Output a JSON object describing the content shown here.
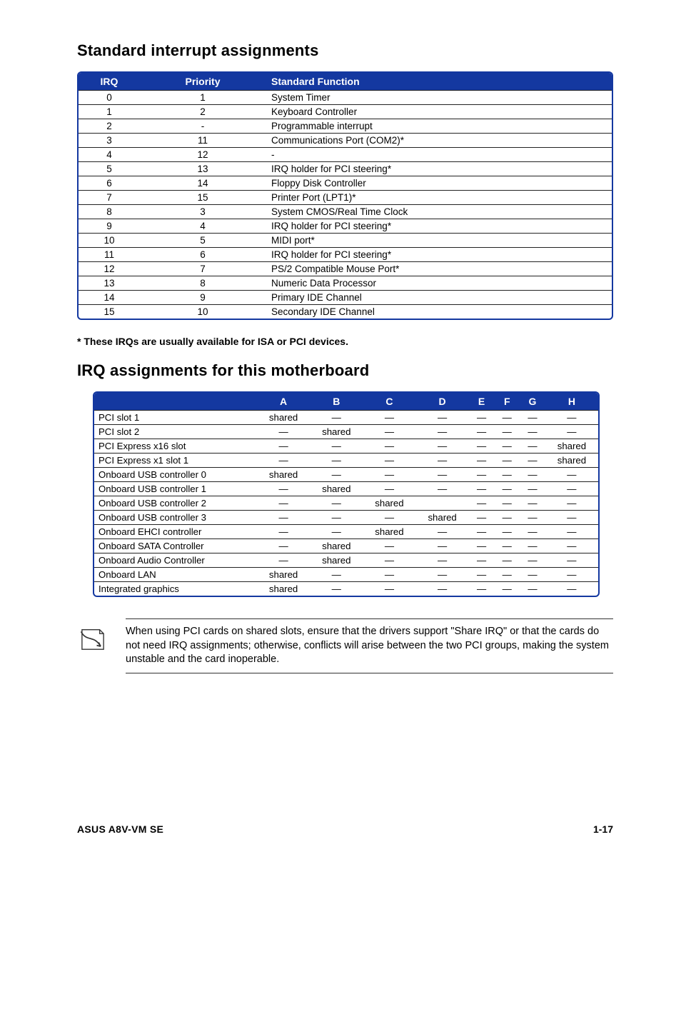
{
  "headings": {
    "std": "Standard interrupt assignments",
    "irq_assign": "IRQ assignments for this motherboard"
  },
  "irq_table": {
    "columns": {
      "irq": "IRQ",
      "priority": "Priority",
      "func": "Standard Function"
    },
    "rows": [
      {
        "irq": "0",
        "priority": "1",
        "func": "System Timer"
      },
      {
        "irq": "1",
        "priority": "2",
        "func": "Keyboard Controller"
      },
      {
        "irq": "2",
        "priority": "-",
        "func": "Programmable interrupt"
      },
      {
        "irq": "3",
        "priority": "11",
        "func": "Communications Port (COM2)*"
      },
      {
        "irq": "4",
        "priority": "12",
        "func": "-"
      },
      {
        "irq": "5",
        "priority": "13",
        "func": "IRQ holder for PCI steering*"
      },
      {
        "irq": "6",
        "priority": "14",
        "func": "Floppy Disk Controller"
      },
      {
        "irq": "7",
        "priority": "15",
        "func": "Printer Port (LPT1)*"
      },
      {
        "irq": "8",
        "priority": "3",
        "func": "System CMOS/Real Time Clock"
      },
      {
        "irq": "9",
        "priority": "4",
        "func": "IRQ holder for PCI steering*"
      },
      {
        "irq": "10",
        "priority": "5",
        "func": "MIDI port*"
      },
      {
        "irq": "11",
        "priority": "6",
        "func": "IRQ holder for PCI steering*"
      },
      {
        "irq": "12",
        "priority": "7",
        "func": "PS/2 Compatible Mouse Port*"
      },
      {
        "irq": "13",
        "priority": "8",
        "func": "Numeric Data Processor"
      },
      {
        "irq": "14",
        "priority": "9",
        "func": "Primary IDE Channel"
      },
      {
        "irq": "15",
        "priority": "10",
        "func": "Secondary IDE Channel"
      }
    ]
  },
  "footnote": "* These IRQs are usually available for ISA or PCI devices.",
  "assign_table": {
    "columns": [
      "",
      "A",
      "B",
      "C",
      "D",
      "E",
      "F",
      "G",
      "H"
    ],
    "rows": [
      {
        "label": "PCI slot 1",
        "cells": [
          "shared",
          "—",
          "—",
          "—",
          "—",
          "—",
          "—",
          "—"
        ]
      },
      {
        "label": "PCI slot 2",
        "cells": [
          "—",
          "shared",
          "—",
          "—",
          "—",
          "—",
          "—",
          "—"
        ]
      },
      {
        "label": "PCI Express x16 slot",
        "cells": [
          "—",
          "—",
          "—",
          "—",
          "—",
          "—",
          "—",
          "shared"
        ]
      },
      {
        "label": "PCI Express x1 slot 1",
        "cells": [
          "—",
          "—",
          "—",
          "—",
          "—",
          "—",
          "—",
          "shared"
        ]
      },
      {
        "label": "Onboard USB controller 0",
        "cells": [
          "shared",
          "—",
          "—",
          "—",
          "—",
          "—",
          "—",
          "—"
        ]
      },
      {
        "label": "Onboard USB controller 1",
        "cells": [
          "—",
          "shared",
          "—",
          "—",
          "—",
          "—",
          "—",
          "—"
        ]
      },
      {
        "label": "Onboard USB controller 2",
        "cells": [
          "—",
          "—",
          "shared",
          "",
          "—",
          "—",
          "—",
          "—"
        ]
      },
      {
        "label": "Onboard USB controller 3",
        "cells": [
          "—",
          "—",
          "—",
          "shared",
          "—",
          "—",
          "—",
          "—"
        ]
      },
      {
        "label": "Onboard EHCI controller",
        "cells": [
          "—",
          "—",
          "shared",
          "—",
          "—",
          "—",
          "—",
          "—"
        ]
      },
      {
        "label": "Onboard SATA Controller",
        "cells": [
          "—",
          "shared",
          "—",
          "—",
          "—",
          "—",
          "—",
          "—"
        ]
      },
      {
        "label": "Onboard Audio Controller",
        "cells": [
          "—",
          "shared",
          "—",
          "—",
          "—",
          "—",
          "—",
          "—"
        ]
      },
      {
        "label": "Onboard LAN",
        "cells": [
          "shared",
          "—",
          "—",
          "—",
          "—",
          "—",
          "—",
          "—"
        ]
      },
      {
        "label": "Integrated graphics",
        "cells": [
          "shared",
          "—",
          "—",
          "—",
          "—",
          "—",
          "—",
          "—"
        ]
      }
    ]
  },
  "note": "When using PCI cards on shared slots, ensure that the drivers support \"Share IRQ\" or that the cards do not need IRQ assignments; otherwise, conflicts will arise between the two PCI groups, making the system unstable and the card inoperable.",
  "footer": {
    "model": "ASUS A8V-VM SE",
    "page": "1-17"
  }
}
